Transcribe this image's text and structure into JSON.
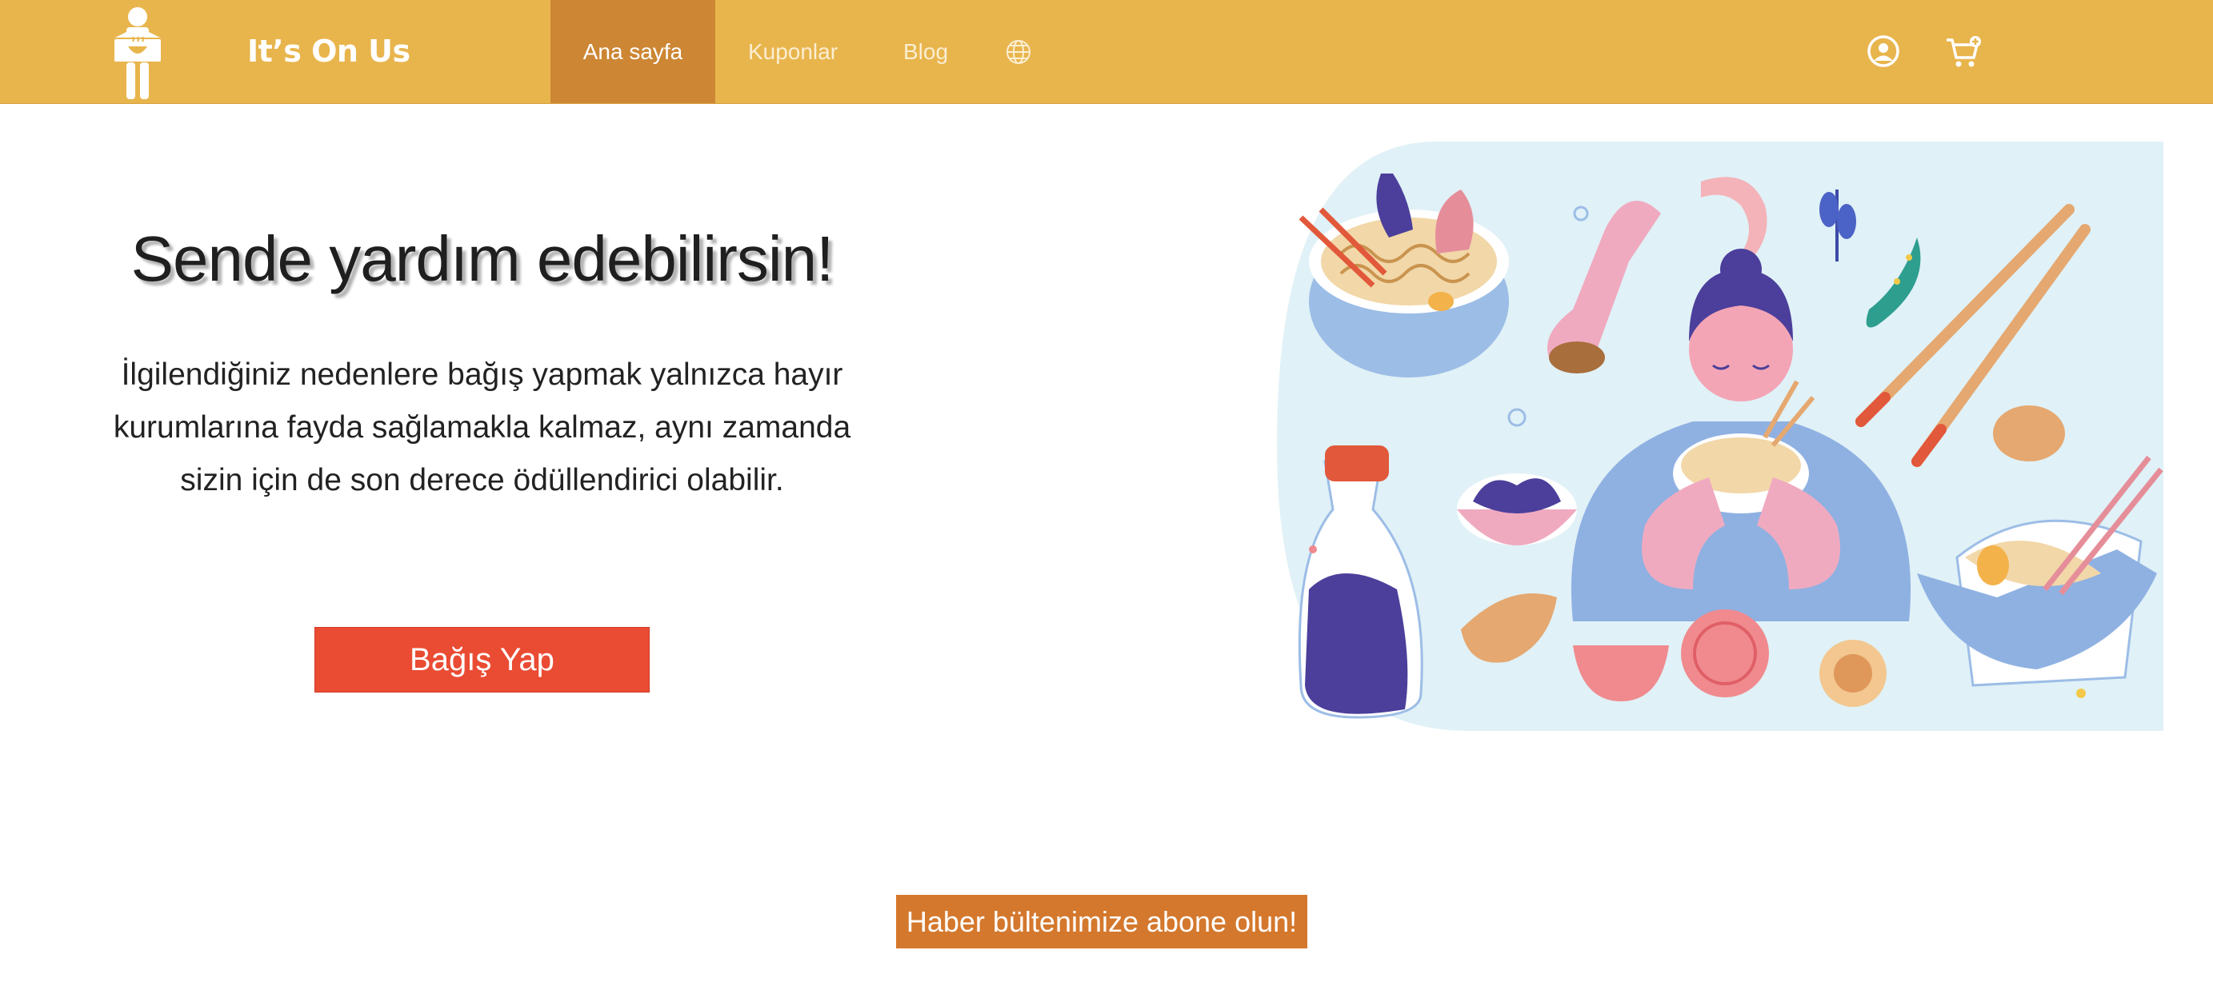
{
  "brand": {
    "name": "It’s On Us",
    "logo_icon": "person-holding-bowl-icon"
  },
  "nav": {
    "items": [
      {
        "label": "Ana sayfa",
        "active": true
      },
      {
        "label": "Kuponlar",
        "active": false
      },
      {
        "label": "Blog",
        "active": false
      }
    ],
    "language_icon": "globe-icon",
    "account_icon": "user-circle-icon",
    "cart_icon": "cart-plus-icon"
  },
  "hero": {
    "title": "Sende yardım edebilirsin!",
    "text": "İlgilendiğiniz nedenlere bağış yapmak yalnızca hayır kurumlarına fayda sağlamakla kalmaz, aynı zamanda sizin için de son derece ödüllendirici olabilir.",
    "donate_label": "Bağış Yap",
    "illustration_icon": "woman-eating-noodles-illustration"
  },
  "newsletter": {
    "label": "Haber bültenimize abone olun!"
  },
  "colors": {
    "navbar": "#e8b54d",
    "nav_active": "#cd8633",
    "donate_button": "#ea4b33",
    "newsletter_button": "#d4782d",
    "illustration_bg": "#e0f1f7"
  }
}
